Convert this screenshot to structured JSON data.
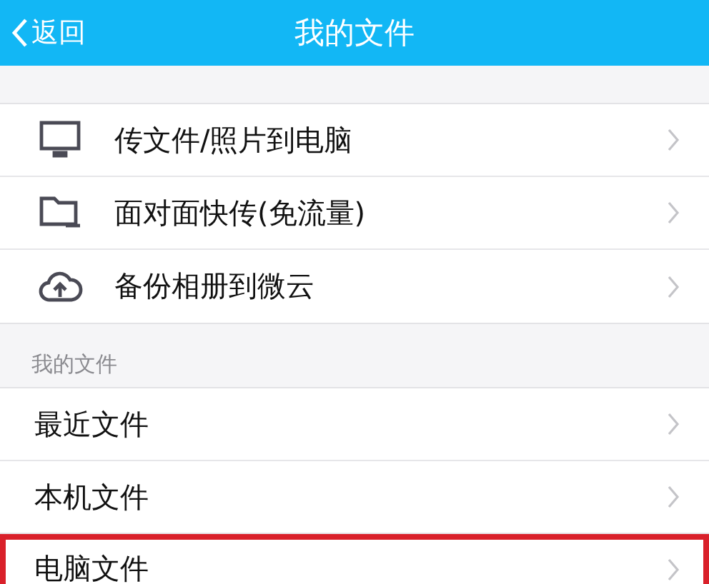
{
  "header": {
    "back": "返回",
    "title": "我的文件"
  },
  "actions": [
    {
      "kind": "monitor",
      "label": "传文件/照片到电脑"
    },
    {
      "kind": "folder",
      "label": "面对面快传(免流量)"
    },
    {
      "kind": "cloud",
      "label": "备份相册到微云"
    }
  ],
  "section": {
    "title": "我的文件",
    "items": [
      {
        "label": "最近文件",
        "highlighted": false
      },
      {
        "label": "本机文件",
        "highlighted": false
      },
      {
        "label": "电脑文件",
        "highlighted": true
      }
    ]
  }
}
